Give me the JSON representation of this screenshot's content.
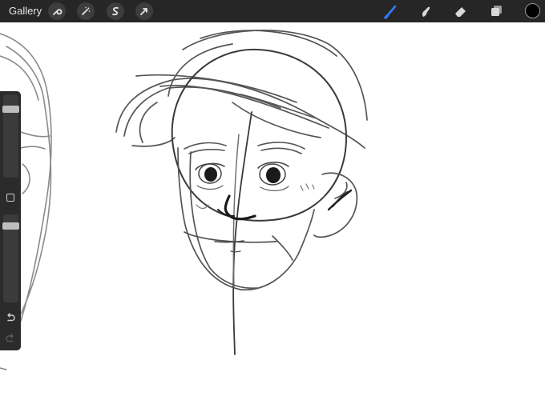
{
  "app": {
    "gallery_label": "Gallery"
  },
  "colors": {
    "topbar": "#262626",
    "active_brush": "#2f7cf6",
    "current_color": "#000000",
    "sidebar": "#2b2b2b"
  },
  "toolbar_left": [
    {
      "name": "wrench-icon"
    },
    {
      "name": "magic-wand-icon"
    },
    {
      "name": "selection-icon"
    },
    {
      "name": "transform-arrow-icon"
    }
  ],
  "toolbar_right": [
    {
      "name": "brush-icon",
      "active": true
    },
    {
      "name": "smudge-icon",
      "active": false
    },
    {
      "name": "eraser-icon",
      "active": false
    },
    {
      "name": "layers-icon",
      "active": false
    }
  ],
  "sidebar": {
    "brush_size_level": 0.85,
    "opacity_level": 0.9,
    "icons": [
      "modify-button-icon",
      "undo-icon",
      "redo-icon"
    ]
  }
}
